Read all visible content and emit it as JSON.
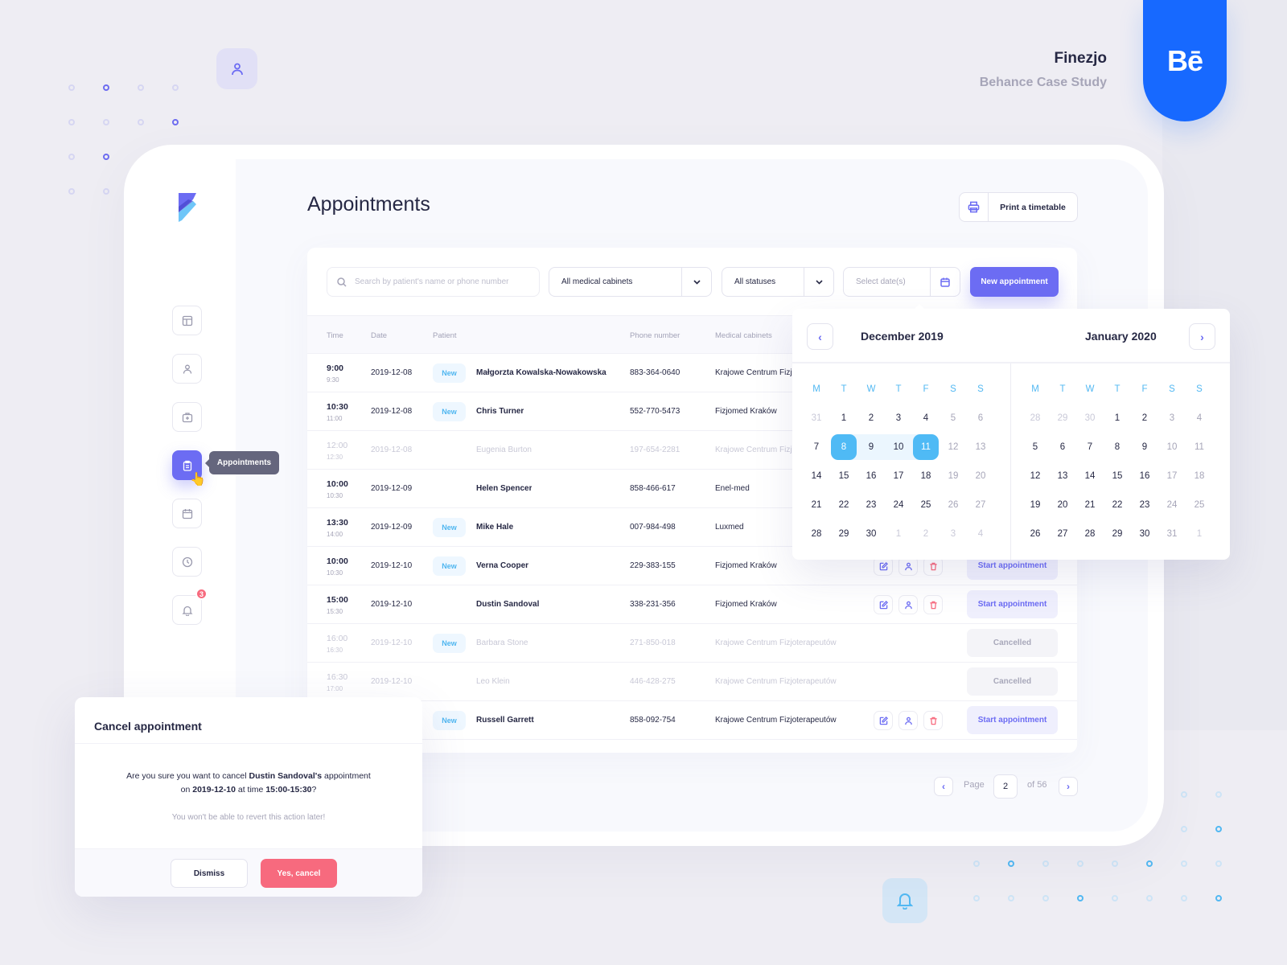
{
  "brand": {
    "title": "Finezjo",
    "subtitle": "Behance Case Study",
    "behance_logo": "Bē"
  },
  "colors": {
    "accent": "#6c6cf3",
    "calendar_accent": "#4fbaf5",
    "danger": "#f76a7e",
    "behance": "#1769ff"
  },
  "sidebar": {
    "items": [
      {
        "name": "dashboard",
        "icon": "layout-icon"
      },
      {
        "name": "patients",
        "icon": "user-icon"
      },
      {
        "name": "medical",
        "icon": "medical-kit-icon"
      },
      {
        "name": "appointments",
        "icon": "clipboard-icon",
        "active": true
      },
      {
        "name": "calendar",
        "icon": "calendar-icon"
      },
      {
        "name": "history",
        "icon": "clock-icon"
      },
      {
        "name": "notifications",
        "icon": "bell-icon",
        "badge": "3"
      }
    ],
    "tooltip": "Appointments"
  },
  "page": {
    "title": "Appointments",
    "print_label": "Print a timetable"
  },
  "filters": {
    "search_placeholder": "Search by patient's name or phone number",
    "cabinets": "All medical cabinets",
    "statuses": "All statuses",
    "date_placeholder": "Select date(s)",
    "new_label": "New appointment"
  },
  "table": {
    "headers": {
      "time": "Time",
      "date": "Date",
      "patient": "Patient",
      "phone": "Phone number",
      "cabinet": "Medical cabinets"
    },
    "new_badge": "New",
    "start_label": "Start appointment",
    "cancelled_label": "Cancelled",
    "rows": [
      {
        "start": "9:00",
        "end": "9:30",
        "date": "2019-12-08",
        "new": true,
        "patient": "Małgorzta Kowalska-Nowakowska",
        "phone": "883-364-0640",
        "cabinet": "Krajowe Centrum Fizjoterapeutów",
        "status": "active"
      },
      {
        "start": "10:30",
        "end": "11:00",
        "date": "2019-12-08",
        "new": true,
        "patient": "Chris Turner",
        "phone": "552-770-5473",
        "cabinet": "Fizjomed Kraków",
        "status": "active"
      },
      {
        "start": "12:00",
        "end": "12:30",
        "date": "2019-12-08",
        "new": false,
        "patient": "Eugenia Burton",
        "phone": "197-654-2281",
        "cabinet": "Krajowe Centrum Fizjoterapeutów",
        "status": "dimmed"
      },
      {
        "start": "10:00",
        "end": "10:30",
        "date": "2019-12-09",
        "new": false,
        "patient": "Helen Spencer",
        "phone": "858-466-617",
        "cabinet": "Enel-med",
        "status": "active"
      },
      {
        "start": "13:30",
        "end": "14:00",
        "date": "2019-12-09",
        "new": true,
        "patient": "Mike Hale",
        "phone": "007-984-498",
        "cabinet": "Luxmed",
        "status": "active"
      },
      {
        "start": "10:00",
        "end": "10:30",
        "date": "2019-12-10",
        "new": true,
        "patient": "Verna Cooper",
        "phone": "229-383-155",
        "cabinet": "Fizjomed Kraków",
        "status": "active"
      },
      {
        "start": "15:00",
        "end": "15:30",
        "date": "2019-12-10",
        "new": false,
        "patient": "Dustin Sandoval",
        "phone": "338-231-356",
        "cabinet": "Fizjomed Kraków",
        "status": "active"
      },
      {
        "start": "16:00",
        "end": "16:30",
        "date": "2019-12-10",
        "new": true,
        "patient": "Barbara Stone",
        "phone": "271-850-018",
        "cabinet": "Krajowe Centrum Fizjoterapeutów",
        "status": "cancelled"
      },
      {
        "start": "16:30",
        "end": "17:00",
        "date": "2019-12-10",
        "new": false,
        "patient": "Leo Klein",
        "phone": "446-428-275",
        "cabinet": "Krajowe Centrum Fizjoterapeutów",
        "status": "cancelled"
      },
      {
        "start": "",
        "end": "",
        "date": "",
        "new": true,
        "patient": "Russell Garrett",
        "phone": "858-092-754",
        "cabinet": "Krajowe Centrum Fizjoterapeutów",
        "status": "active"
      }
    ]
  },
  "pagination": {
    "label": "Page",
    "current": "2",
    "of": "of 56"
  },
  "calendar": {
    "weekdays": [
      "M",
      "T",
      "W",
      "T",
      "F",
      "S",
      "S"
    ],
    "months": [
      {
        "title": "December 2019",
        "weeks": [
          [
            "31",
            "1",
            "2",
            "3",
            "4",
            "5",
            "6"
          ],
          [
            "7",
            "8",
            "9",
            "10",
            "11",
            "12",
            "13"
          ],
          [
            "14",
            "15",
            "16",
            "17",
            "18",
            "19",
            "20"
          ],
          [
            "21",
            "22",
            "23",
            "24",
            "25",
            "26",
            "27"
          ],
          [
            "28",
            "29",
            "30",
            "1",
            "2",
            "3",
            "4"
          ]
        ],
        "outside": [
          [
            0
          ],
          [],
          [],
          [],
          [
            3,
            4,
            5,
            6
          ]
        ],
        "range": {
          "week": 1,
          "from": 1,
          "to": 4
        }
      },
      {
        "title": "January 2020",
        "weeks": [
          [
            "28",
            "29",
            "30",
            "1",
            "2",
            "3",
            "4"
          ],
          [
            "5",
            "6",
            "7",
            "8",
            "9",
            "10",
            "11"
          ],
          [
            "12",
            "13",
            "14",
            "15",
            "16",
            "17",
            "18"
          ],
          [
            "19",
            "20",
            "21",
            "22",
            "23",
            "24",
            "25"
          ],
          [
            "26",
            "27",
            "28",
            "29",
            "30",
            "31",
            "1"
          ]
        ],
        "outside": [
          [
            0,
            1,
            2
          ],
          [],
          [],
          [],
          [
            6
          ]
        ],
        "range": null
      }
    ]
  },
  "modal": {
    "title": "Cancel appointment",
    "text_before": "Are you sure you want to cancel ",
    "patient": "Dustin Sandoval's",
    "text_mid": " appointment",
    "on": "on ",
    "date": "2019-12-10",
    "at": " at time ",
    "time": "15:00-15:30",
    "end": "?",
    "warning": "You won't be able to revert this action later!",
    "dismiss": "Dismiss",
    "confirm": "Yes, cancel"
  }
}
